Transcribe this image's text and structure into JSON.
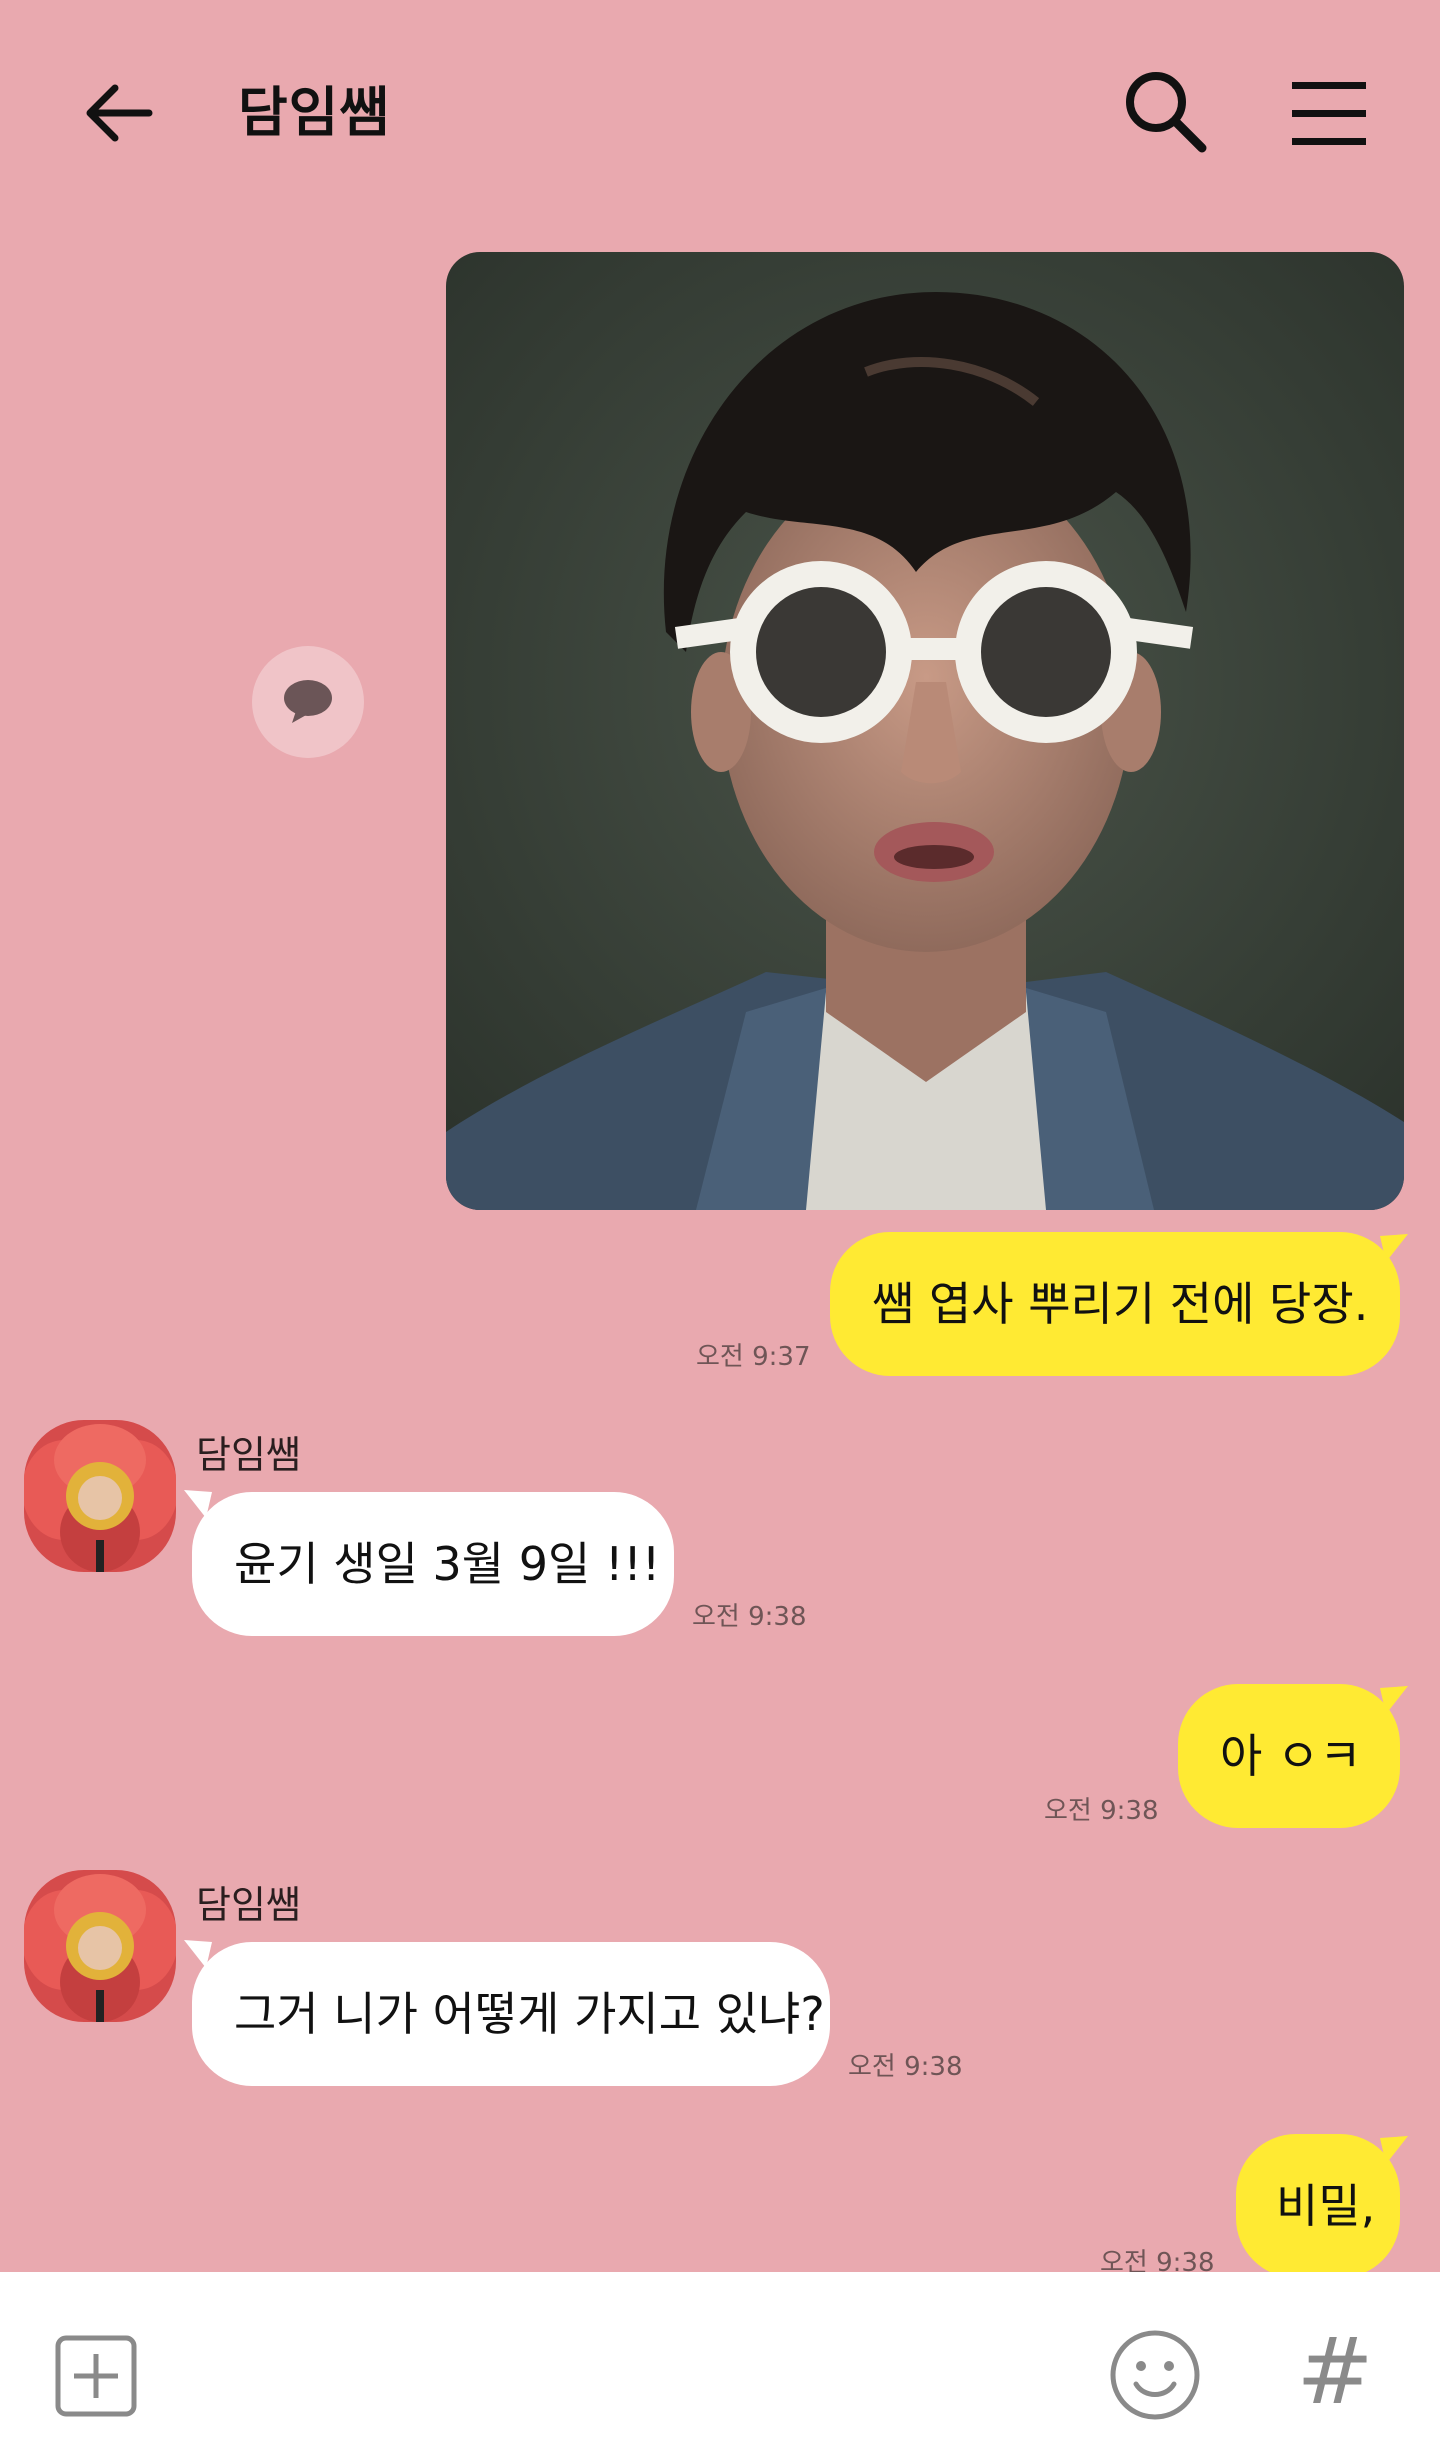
{
  "app": {
    "background_color": "#E9A9AF",
    "my_bubble_color": "#FFEA33",
    "their_bubble_color": "#FFFFFF"
  },
  "header": {
    "back_icon": "arrow-left-icon",
    "title": "담임쌤",
    "search_icon": "search-icon",
    "menu_icon": "hamburger-menu-icon"
  },
  "messages": [
    {
      "from": "me",
      "type": "photo",
      "share_icon": "speech-bubble-icon"
    },
    {
      "from": "me",
      "text": "쌤 엽사 뿌리기 전에 당장.",
      "time": "오전 9:37"
    },
    {
      "from": "them",
      "sender": "담임쌤",
      "text": "윤기 생일 3월 9일 !!!",
      "time": "오전 9:38"
    },
    {
      "from": "me",
      "text": "아 ㅇㅋ",
      "time": "오전 9:38"
    },
    {
      "from": "them",
      "sender": "담임쌤",
      "text": "그거 니가 어떻게 가지고 있냐?",
      "time": "오전 9:38"
    },
    {
      "from": "me",
      "text": "비밀,",
      "time": "오전 9:38"
    }
  ],
  "input_bar": {
    "plus_icon": "plus-square-icon",
    "emoji_icon": "smiley-icon",
    "hash_label": "#"
  }
}
